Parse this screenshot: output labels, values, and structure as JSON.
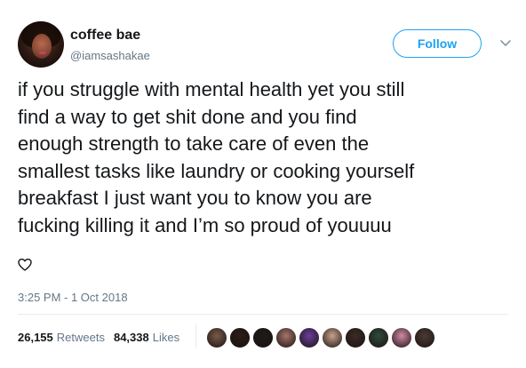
{
  "user": {
    "display_name": "coffee bae",
    "handle": "@iamsashakae"
  },
  "follow_label": "Follow",
  "tweet": {
    "text": "if you struggle with mental health yet you still\nfind a way to get shit done and you find\nenough strength to take care of even the\nsmallest tasks like laundry or cooking yourself\nbreakfast I just want you to know you are\nfucking killing it and I’m so proud of youuuu",
    "emoji": "heart-outline-icon",
    "timestamp": "3:25 PM - 1 Oct 2018"
  },
  "stats": {
    "retweets_count": "26,155",
    "retweets_label": "Retweets",
    "likes_count": "84,338",
    "likes_label": "Likes"
  },
  "colors": {
    "accent": "#1da1f2",
    "text": "#14171a",
    "secondary": "#657786",
    "divider": "#e6ecf0"
  },
  "likers": [
    {
      "name": "liker-avatar-1",
      "color": "#7a5a4a"
    },
    {
      "name": "liker-avatar-2",
      "color": "#2b1d16"
    },
    {
      "name": "liker-avatar-3",
      "color": "#1f1a1a"
    },
    {
      "name": "liker-avatar-4",
      "color": "#a7746a"
    },
    {
      "name": "liker-avatar-5",
      "color": "#6a3f9c"
    },
    {
      "name": "liker-avatar-6",
      "color": "#c9a28c"
    },
    {
      "name": "liker-avatar-7",
      "color": "#3a2b25"
    },
    {
      "name": "liker-avatar-8",
      "color": "#2f4b3c"
    },
    {
      "name": "liker-avatar-9",
      "color": "#d08aa8"
    },
    {
      "name": "liker-avatar-10",
      "color": "#4a3b33"
    }
  ]
}
